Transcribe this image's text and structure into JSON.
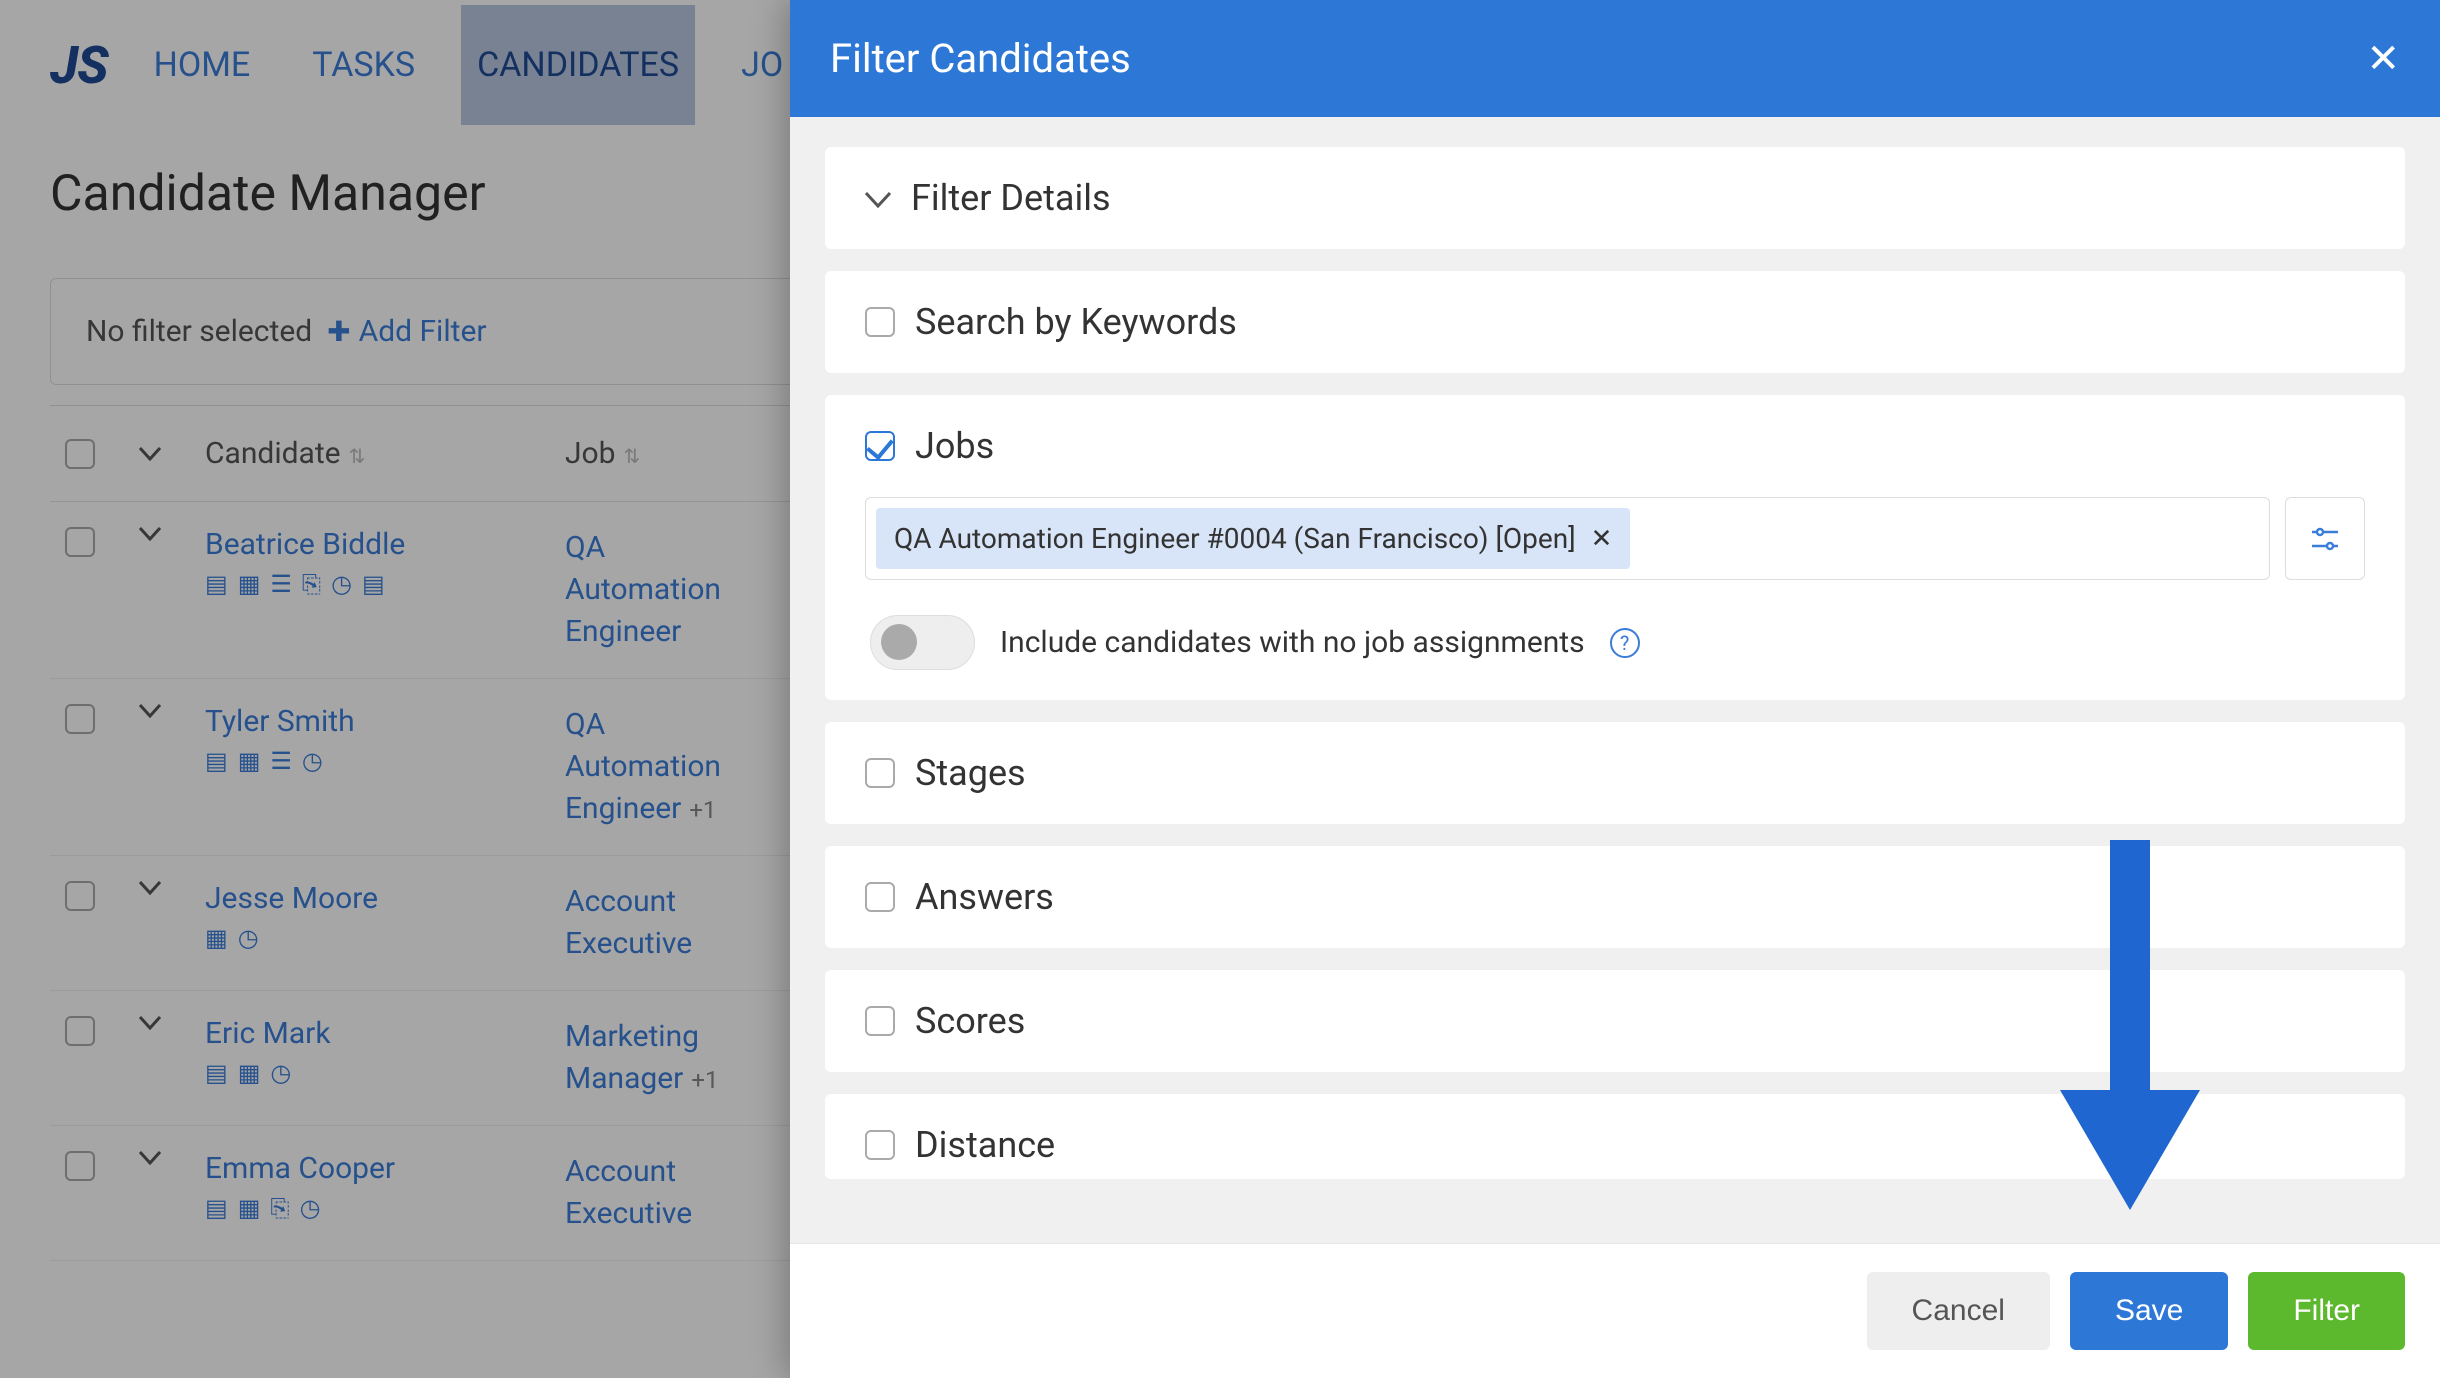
{
  "nav": {
    "logo": "JS",
    "home": "HOME",
    "tasks": "TASKS",
    "candidates": "CANDIDATES",
    "jobs_partial": "JO"
  },
  "page": {
    "title": "Candidate Manager",
    "no_filter": "No filter selected",
    "add_filter": "Add Filter"
  },
  "table": {
    "col_candidate": "Candidate",
    "col_job": "Job",
    "rows": [
      {
        "name": "Beatrice Biddle",
        "job": "QA Automation Engineer",
        "plus": ""
      },
      {
        "name": "Tyler Smith",
        "job": "QA Automation Engineer",
        "plus": "+1"
      },
      {
        "name": "Jesse Moore",
        "job": "Account Executive",
        "plus": ""
      },
      {
        "name": "Eric Mark",
        "job": "Marketing Manager",
        "plus": "+1"
      },
      {
        "name": "Emma Cooper",
        "job": "Account Executive",
        "plus": ""
      }
    ]
  },
  "modal": {
    "title": "Filter Candidates",
    "filter_details": "Filter Details",
    "search_keywords": "Search by Keywords",
    "jobs": "Jobs",
    "job_chip": "QA Automation Engineer #0004 (San Francisco) [Open]",
    "include_no_job": "Include candidates with no job assignments",
    "stages": "Stages",
    "answers": "Answers",
    "scores": "Scores",
    "distance": "Distance",
    "cancel": "Cancel",
    "save": "Save",
    "filter": "Filter"
  }
}
